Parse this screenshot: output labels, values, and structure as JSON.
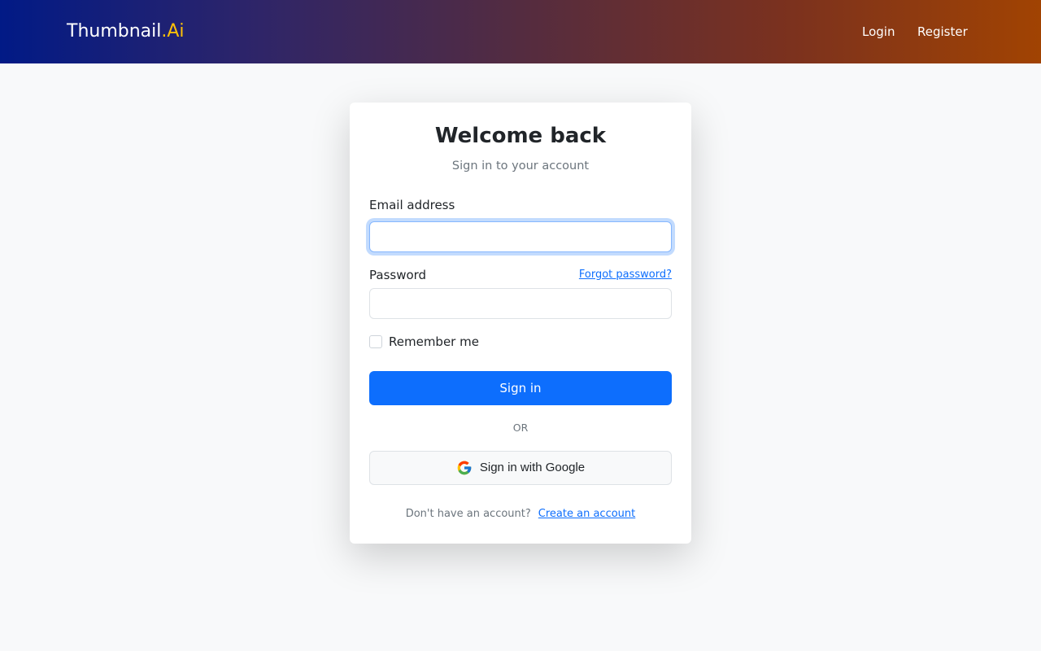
{
  "navbar": {
    "brand_main": "Thumbnail",
    "brand_accent": ".Ai",
    "links": [
      "Login",
      "Register"
    ]
  },
  "card": {
    "title": "Welcome back",
    "subtitle": "Sign in to your account",
    "email": {
      "label": "Email address",
      "value": ""
    },
    "password": {
      "label": "Password",
      "value": "",
      "forgot_link": "Forgot password?"
    },
    "remember_me": {
      "label": "Remember me",
      "checked": false
    },
    "sign_in_button": "Sign in",
    "divider_text": "OR",
    "google_button": {
      "label": "Sign in with Google",
      "icon": "google-icon"
    },
    "footer": {
      "prompt": "Don't have an account?",
      "link": "Create an account"
    }
  },
  "colors": {
    "primary": "#0d6efd",
    "brand_accent": "#ffc107",
    "navbar_gradient_start": "#011a86",
    "navbar_gradient_end": "#a14302"
  }
}
